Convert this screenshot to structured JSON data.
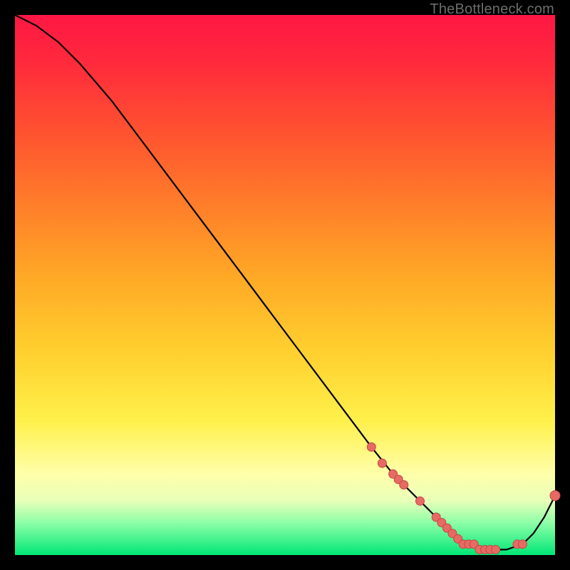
{
  "watermark": "TheBottleneck.com",
  "chart_data": {
    "type": "line",
    "title": "",
    "xlabel": "",
    "ylabel": "",
    "xlim": [
      0,
      100
    ],
    "ylim": [
      0,
      100
    ],
    "grid": false,
    "series": [
      {
        "name": "curve",
        "x": [
          0,
          4,
          8,
          12,
          18,
          24,
          30,
          36,
          42,
          48,
          54,
          60,
          66,
          70,
          72,
          75,
          78,
          80,
          82,
          85,
          88,
          91,
          94,
          96,
          98,
          100
        ],
        "y": [
          100,
          98,
          95,
          91,
          84,
          76,
          68,
          60,
          52,
          44,
          36,
          28,
          20,
          15,
          13,
          10,
          7,
          5,
          3,
          2,
          1,
          1,
          2,
          4,
          7,
          11
        ]
      }
    ],
    "highlight_points": {
      "x": [
        66,
        68,
        70,
        71,
        72,
        75,
        78,
        79,
        80,
        81,
        82,
        83,
        84,
        85,
        86,
        87,
        88,
        89,
        93,
        94,
        100
      ],
      "y": [
        20,
        17,
        15,
        14,
        13,
        10,
        7,
        6,
        5,
        4,
        3,
        2,
        2,
        2,
        1,
        1,
        1,
        1,
        2,
        2,
        11
      ]
    }
  }
}
